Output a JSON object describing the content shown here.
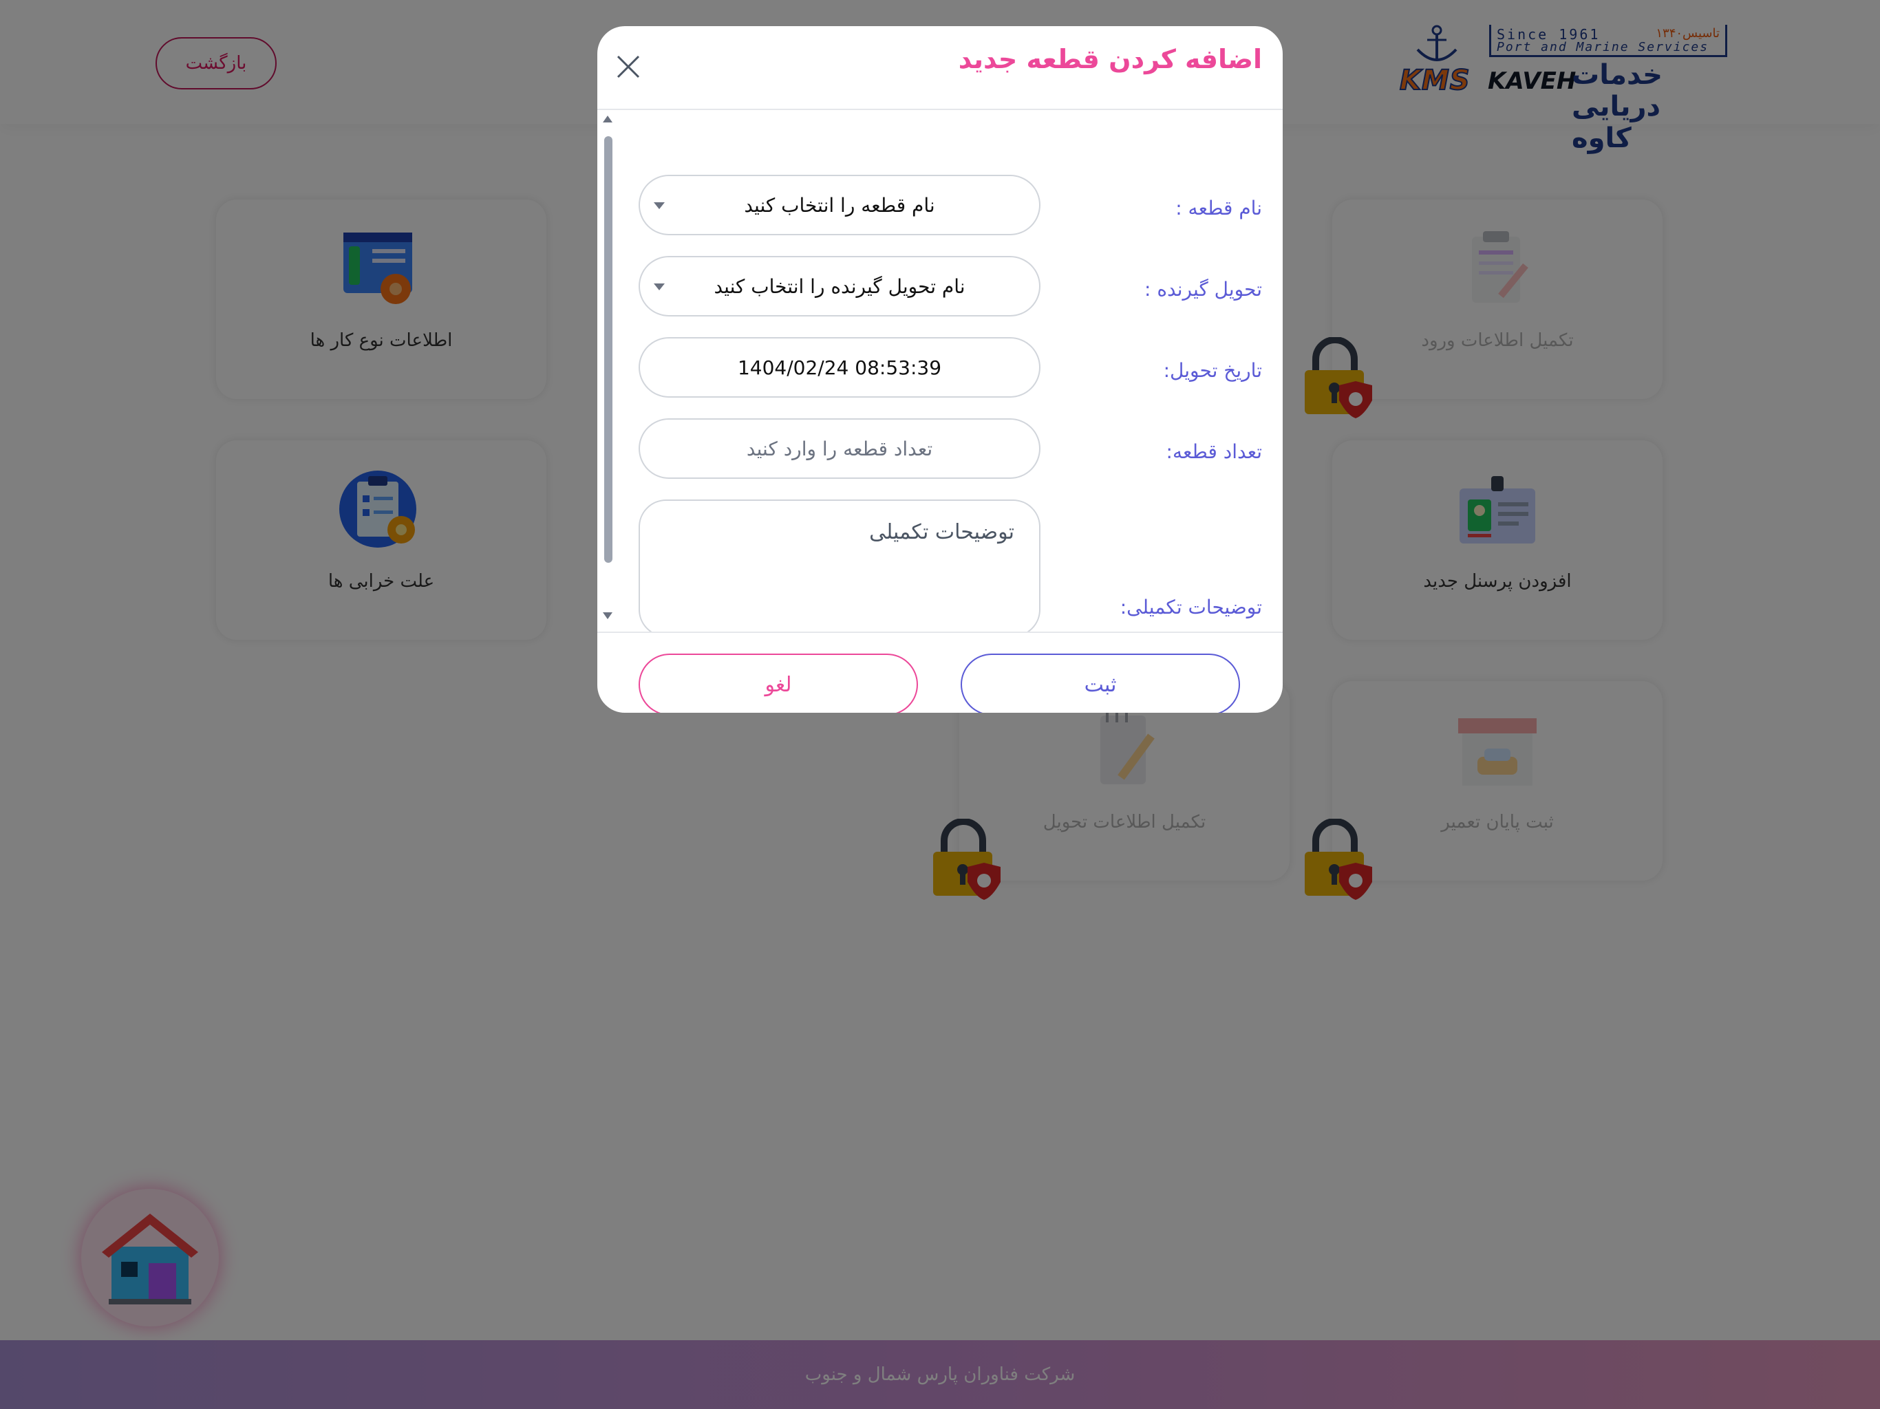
{
  "header": {
    "back_label": "بازگشت",
    "logo": {
      "since_en": "Since 1961",
      "since_fa": "تاسیس۱۳۴۰",
      "services": "Port and Marine Services",
      "kms": "KMS",
      "kaveh": "KAVEH",
      "fa_name": "خدمات دریایی کاوه"
    }
  },
  "cards": [
    {
      "label": "اطلاعات نوع کار ها",
      "icon": "settings-wrench-icon",
      "locked": false
    },
    {
      "label": "علت خرابی ها",
      "icon": "checklist-gear-icon",
      "locked": false
    },
    {
      "label": "تکمیل اطلاعات ورود",
      "icon": "clipboard-pencil-icon",
      "locked": true
    },
    {
      "label": "افزودن پرسنل جدید",
      "icon": "id-badge-icon",
      "locked": false
    },
    {
      "label": "تکمیل اطلاعات تحویل",
      "icon": "notepad-pencil-icon",
      "locked": true
    },
    {
      "label": "ثبت پایان تعمیر",
      "icon": "garage-car-icon",
      "locked": true
    }
  ],
  "footer": {
    "text": "شرکت فناوران پارس شمال و جنوب"
  },
  "modal": {
    "title": "اضافه کردن قطعه جدید",
    "fields": {
      "part_name": {
        "label": "نام قطعه :",
        "value": "نام قطعه را انتخاب کنید"
      },
      "receiver": {
        "label": "تحویل گیرنده :",
        "value": "نام تحویل گیرنده را انتخاب کنید"
      },
      "delivery_date": {
        "label": "تاریخ تحویل:",
        "value": "1404/02/24 08:53:39"
      },
      "quantity": {
        "label": "تعداد قطعه:",
        "placeholder": "تعداد قطعه را وارد کنید"
      },
      "notes": {
        "label": "توضیحات تکمیلی:",
        "placeholder": "توضیحات تکمیلی"
      }
    },
    "submit_label": "ثبت",
    "cancel_label": "لغو"
  },
  "colors": {
    "accent_pink": "#ec4899",
    "accent_purple": "#5b5bd6",
    "back_border": "#c2185b"
  }
}
